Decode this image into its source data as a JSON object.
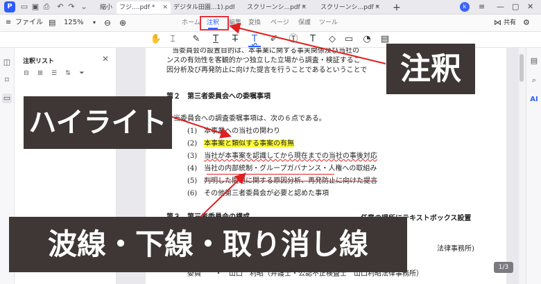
{
  "titlebar": {
    "tabs": [
      {
        "label": "縮小"
      },
      {
        "label": "フジ....pdf *"
      },
      {
        "label": "デジタル田園...1).pdf"
      },
      {
        "label": "スクリーンシ...pdf *"
      },
      {
        "label": "スクリーンシ...pdf *"
      }
    ],
    "avatar_letter": "k"
  },
  "menubar": {
    "file": "ファイル",
    "zoom": "125%",
    "tabs": [
      "ホーム",
      "注釈",
      "編集",
      "変換",
      "ページ",
      "保護",
      "ツール"
    ],
    "active_tab": "注釈",
    "share": "共有"
  },
  "panel": {
    "title": "注釈リスト"
  },
  "document": {
    "line1": "当委員会の設置目的は、本事業に関する事実関係及び当社の",
    "line2": "ンスの有効性を客観的かつ独立した立場から調査・検証するこ",
    "line3": "因分析及び再発防止に向けた提言を行うことであるということで",
    "heading2": "第２　第三者委員会への委嘱事項",
    "intro": "当委員会への調査委嘱事項は、次の６点である。",
    "items": [
      {
        "num": "(1)",
        "text": "本事業への当社の関わり"
      },
      {
        "num": "(2)",
        "text": "本事案と類似する事案の有無"
      },
      {
        "num": "(3)",
        "text": "当社が本事案を認識してから現在までの当社の事後対応"
      },
      {
        "num": "(4)",
        "text": "当社の内部統制・グループガバナンス・人権への取組み"
      },
      {
        "num": "(5)",
        "text": "判明した問題に関する原因分析、再発防止に向けた提言"
      },
      {
        "num": "(6)",
        "text": "その他第三者委員会が必要と認めた事項"
      }
    ],
    "heading3": "第３　第三者委員会の構成",
    "textbox": "任意の場所にテキストボックス設置",
    "member_note": "法律事務所)",
    "member_row": "委員　　・　山口　利昭（弁護士・公認不正検査士　山口利昭法律事務所）"
  },
  "pager": "1/3",
  "callouts": {
    "note": "注釈",
    "highlight": "ハイライト",
    "lines": "波線・下線・取り消し線"
  },
  "colors": {
    "accent": "#2f62ff",
    "callout_bg": "#3e3736",
    "arrow": "#e02020",
    "highlight": "#ffff3a"
  }
}
